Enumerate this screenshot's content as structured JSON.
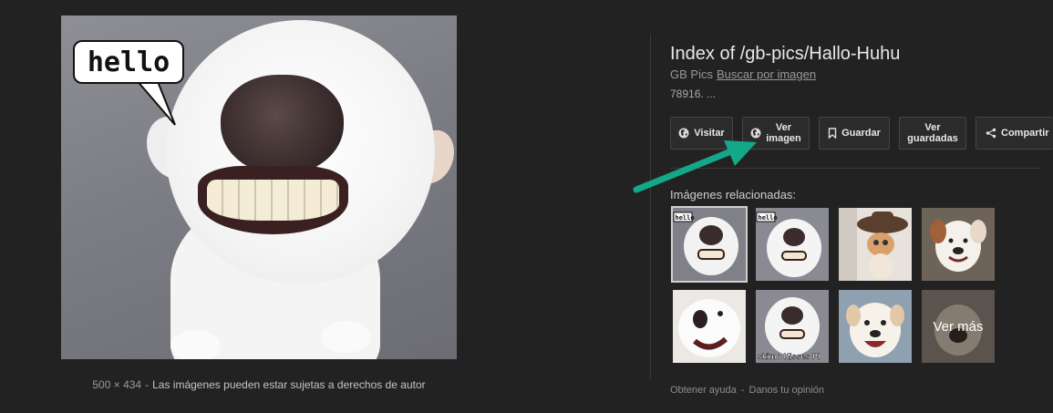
{
  "main_image": {
    "speech_bubble_text": "hello",
    "dimensions": "500 × 434",
    "separator": "-",
    "rights_notice": "Las imágenes pueden estar sujetas a derechos de autor"
  },
  "panel": {
    "title": "Index of /gb-pics/Hallo-Huhu",
    "source_name": "GB Pics",
    "search_by_image": "Buscar por imagen",
    "description": "78916. ...",
    "buttons": {
      "visit": "Visitar",
      "view_image_line1": "Ver",
      "view_image_line2": "imagen",
      "save": "Guardar",
      "view_saved_line1": "Ver",
      "view_saved_line2": "guardadas",
      "share": "Compartir"
    },
    "related_label": "Imágenes relacionadas:",
    "see_more": "Ver más",
    "thumb_texts": {
      "hello_1": "hello",
      "hello_2": "hello",
      "kisses": "skimo Kisses Pl"
    },
    "footer": {
      "help": "Obtener ayuda",
      "separator": "-",
      "feedback": "Danos tu opinión"
    }
  },
  "colors": {
    "background": "#222222",
    "arrow": "#14a88a",
    "button_bg": "#2b2b2b"
  }
}
